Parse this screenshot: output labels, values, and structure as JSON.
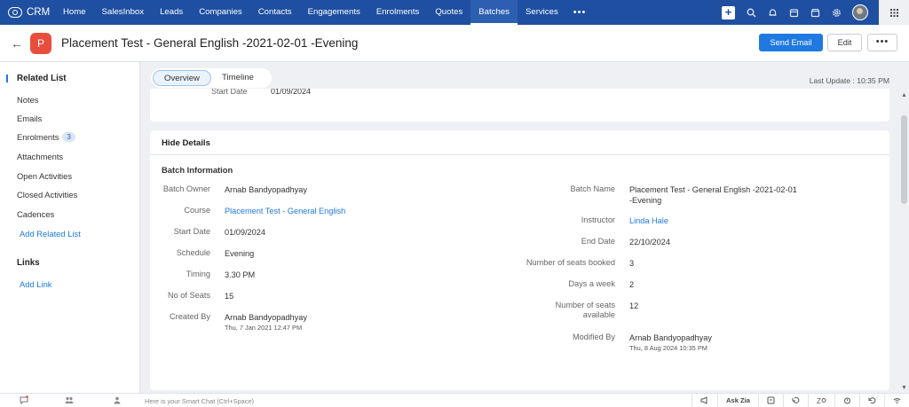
{
  "app": {
    "name": "CRM"
  },
  "topnav": {
    "items": [
      "Home",
      "SalesInbox",
      "Leads",
      "Companies",
      "Contacts",
      "Engagements",
      "Enrolments",
      "Quotes",
      "Batches",
      "Services"
    ],
    "active_index": 8,
    "more": "•••",
    "accent": "#1e4fa1"
  },
  "record": {
    "avatar_letter": "P",
    "title": "Placement Test - General English -2021-02-01 -Evening",
    "send_email": "Send Email",
    "edit": "Edit",
    "more": "•••"
  },
  "sidebar": {
    "related_list": "Related List",
    "items": [
      {
        "label": "Notes"
      },
      {
        "label": "Emails"
      },
      {
        "label": "Enrolments",
        "badge": "3"
      },
      {
        "label": "Attachments"
      },
      {
        "label": "Open Activities"
      },
      {
        "label": "Closed Activities"
      },
      {
        "label": "Cadences"
      }
    ],
    "add_related_list": "Add Related List",
    "links": "Links",
    "add_link": "Add Link"
  },
  "tabs": {
    "overview": "Overview",
    "timeline": "Timeline"
  },
  "last_update": "Last Update : 10:35 PM",
  "partial_card": {
    "label": "Start Date",
    "value": "01/09/2024"
  },
  "details": {
    "hide_details": "Hide Details",
    "section_title": "Batch Information",
    "left": [
      {
        "label": "Batch Owner",
        "value": "Arnab Bandyopadhyay"
      },
      {
        "label": "Course",
        "value": "Placement Test - General English",
        "link": true
      },
      {
        "label": "Start Date",
        "value": "01/09/2024"
      },
      {
        "label": "Schedule",
        "value": "Evening"
      },
      {
        "label": "Timing",
        "value": "3.30 PM"
      },
      {
        "label": "No of Seats",
        "value": "15"
      },
      {
        "label": "Created By",
        "value": "Arnab Bandyopadhyay",
        "sub": "Thu, 7 Jan 2021 12:47 PM"
      }
    ],
    "right": [
      {
        "label": "Batch Name",
        "value": "Placement Test - General English -2021-02-01 -Evening"
      },
      {
        "label": "Instructor",
        "value": "Linda Hale",
        "link": true
      },
      {
        "label": "End Date",
        "value": "22/10/2024"
      },
      {
        "label": "Number of seats booked",
        "value": "3"
      },
      {
        "label": "Days a week",
        "value": "2"
      },
      {
        "label": "Number of seats available",
        "value": "12"
      },
      {
        "label": "Modified By",
        "value": "Arnab Bandyopadhyay",
        "sub": "Thu, 8 Aug 2024 10:35 PM"
      }
    ]
  },
  "bottombar": {
    "chat_placeholder": "Here is your Smart Chat (Ctrl+Space)",
    "ask_zia": "Ask Zia"
  }
}
